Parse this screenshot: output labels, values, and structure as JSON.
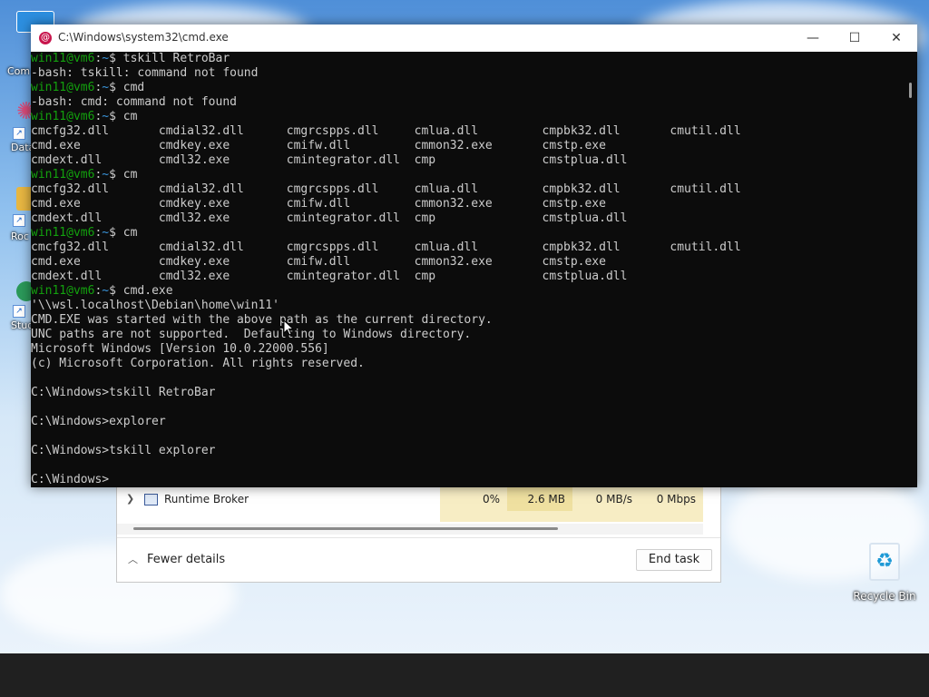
{
  "desktop": {
    "left_icons": [
      {
        "label": "Com",
        "color": "#2d8fe0"
      },
      {
        "label": "Data",
        "color": "#d94b79"
      },
      {
        "label": "Roc",
        "color": "#e8b742"
      },
      {
        "label": "Stud",
        "color": "#2b9a5a"
      }
    ],
    "recycle_bin_label": "Recycle Bin"
  },
  "task_manager": {
    "process_name": "Runtime Broker",
    "cpu": "0%",
    "memory": "2.6 MB",
    "disk": "0 MB/s",
    "network": "0 Mbps",
    "fewer_details_label": "Fewer details",
    "end_task_label": "End task",
    "colors": {
      "highlight_light": "#f7edc4",
      "highlight_dark": "#efe0a0"
    }
  },
  "cmd": {
    "title": "C:\\Windows\\system32\\cmd.exe",
    "minimize_symbol": "—",
    "maximize_symbol": "☐",
    "close_symbol": "✕",
    "prompt_user": "win11@vm6",
    "prompt_path": "~",
    "lines": [
      {
        "type": "prompt",
        "cmd": " tskill RetroBar"
      },
      {
        "type": "out",
        "text": "-bash: tskill: command not found"
      },
      {
        "type": "prompt",
        "cmd": " cmd"
      },
      {
        "type": "out",
        "text": "-bash: cmd: command not found"
      },
      {
        "type": "prompt",
        "cmd": " cm"
      },
      {
        "type": "out",
        "text": "cmcfg32.dll       cmdial32.dll      cmgrcspps.dll     cmlua.dll         cmpbk32.dll       cmutil.dll"
      },
      {
        "type": "out",
        "text": "cmd.exe           cmdkey.exe        cmifw.dll         cmmon32.exe       cmstp.exe"
      },
      {
        "type": "out",
        "text": "cmdext.dll        cmdl32.exe        cmintegrator.dll  cmp               cmstplua.dll"
      },
      {
        "type": "prompt",
        "cmd": " cm"
      },
      {
        "type": "out",
        "text": "cmcfg32.dll       cmdial32.dll      cmgrcspps.dll     cmlua.dll         cmpbk32.dll       cmutil.dll"
      },
      {
        "type": "out",
        "text": "cmd.exe           cmdkey.exe        cmifw.dll         cmmon32.exe       cmstp.exe"
      },
      {
        "type": "out",
        "text": "cmdext.dll        cmdl32.exe        cmintegrator.dll  cmp               cmstplua.dll"
      },
      {
        "type": "prompt",
        "cmd": " cm"
      },
      {
        "type": "out",
        "text": "cmcfg32.dll       cmdial32.dll      cmgrcspps.dll     cmlua.dll         cmpbk32.dll       cmutil.dll"
      },
      {
        "type": "out",
        "text": "cmd.exe           cmdkey.exe        cmifw.dll         cmmon32.exe       cmstp.exe"
      },
      {
        "type": "out",
        "text": "cmdext.dll        cmdl32.exe        cmintegrator.dll  cmp               cmstplua.dll"
      },
      {
        "type": "prompt",
        "cmd": " cmd.exe"
      },
      {
        "type": "out",
        "text": "'\\\\wsl.localhost\\Debian\\home\\win11'"
      },
      {
        "type": "out",
        "text": "CMD.EXE was started with the above path as the current directory."
      },
      {
        "type": "out",
        "text": "UNC paths are not supported.  Defaulting to Windows directory."
      },
      {
        "type": "out",
        "text": "Microsoft Windows [Version 10.0.22000.556]"
      },
      {
        "type": "out",
        "text": "(c) Microsoft Corporation. All rights reserved."
      },
      {
        "type": "out",
        "text": ""
      },
      {
        "type": "out",
        "text": "C:\\Windows>tskill RetroBar"
      },
      {
        "type": "out",
        "text": ""
      },
      {
        "type": "out",
        "text": "C:\\Windows>explorer"
      },
      {
        "type": "out",
        "text": ""
      },
      {
        "type": "out",
        "text": "C:\\Windows>tskill explorer"
      },
      {
        "type": "out",
        "text": ""
      },
      {
        "type": "out",
        "text": "C:\\Windows>"
      }
    ],
    "colors": {
      "user": "#13a10e",
      "path": "#3a96dd",
      "text": "#cccccc",
      "background": "#0c0c0c"
    }
  }
}
